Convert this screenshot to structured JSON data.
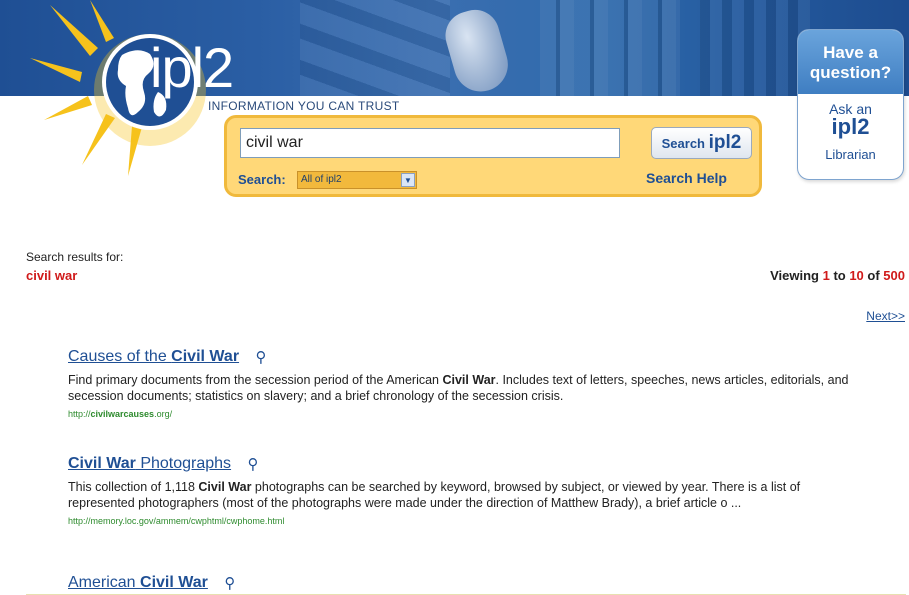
{
  "header": {
    "logo_text": "ipl2",
    "tagline": "INFORMATION YOU CAN TRUST"
  },
  "search": {
    "query_value": "civil war",
    "button_label": "Search ",
    "button_brand": "ipl2",
    "scope_label": "Search:",
    "scope_selected": "All of ipl2",
    "help_link": "Search Help"
  },
  "ask_librarian": {
    "question": "Have a question?",
    "label": "Ask an",
    "brand": "ipl2",
    "sub": "Librarian"
  },
  "results_meta": {
    "label": "Search results for:",
    "query": "civil war",
    "viewing_prefix": "Viewing ",
    "from": "1",
    "to_word": " to ",
    "to": "10",
    "of_word": " of ",
    "total": "500",
    "next_link": "Next>>"
  },
  "results": [
    {
      "title_pre": "Causes of the ",
      "title_bold": "Civil War",
      "title_post": "",
      "desc_1": "Find primary documents from the secession period of the American ",
      "desc_bold": "Civil War",
      "desc_2": ". Includes text of letters, speeches, news articles, editorials, and secession documents; statistics on slavery; and a brief chronology of the secession crisis.",
      "url_pre": "http://",
      "url_bold": "civilwarcauses",
      "url_post": ".org/"
    },
    {
      "title_pre": "",
      "title_bold": "Civil War",
      "title_post": " Photographs",
      "desc_1": "This collection of 1,118 ",
      "desc_bold": "Civil War",
      "desc_2": " photographs can be searched by keyword, browsed by subject, or viewed by year. There is a list of represented photographers (most of the photographs were made under the direction of Matthew Brady), a brief article o ...",
      "url_pre": "http://memory.loc.gov/ammem/cwphtml/cwphome.html",
      "url_bold": "",
      "url_post": ""
    },
    {
      "title_pre": "American ",
      "title_bold": "Civil War",
      "title_post": ""
    }
  ],
  "icons": {
    "magnify": "magnifier-icon",
    "logo": "globe-sun-logo-icon",
    "dropdown": "chevron-down-icon"
  },
  "colors": {
    "brand_blue": "#1f4f94",
    "panel_yellow": "#ffd878",
    "highlight_red": "#d01a1a",
    "url_green": "#2e8b2e"
  }
}
